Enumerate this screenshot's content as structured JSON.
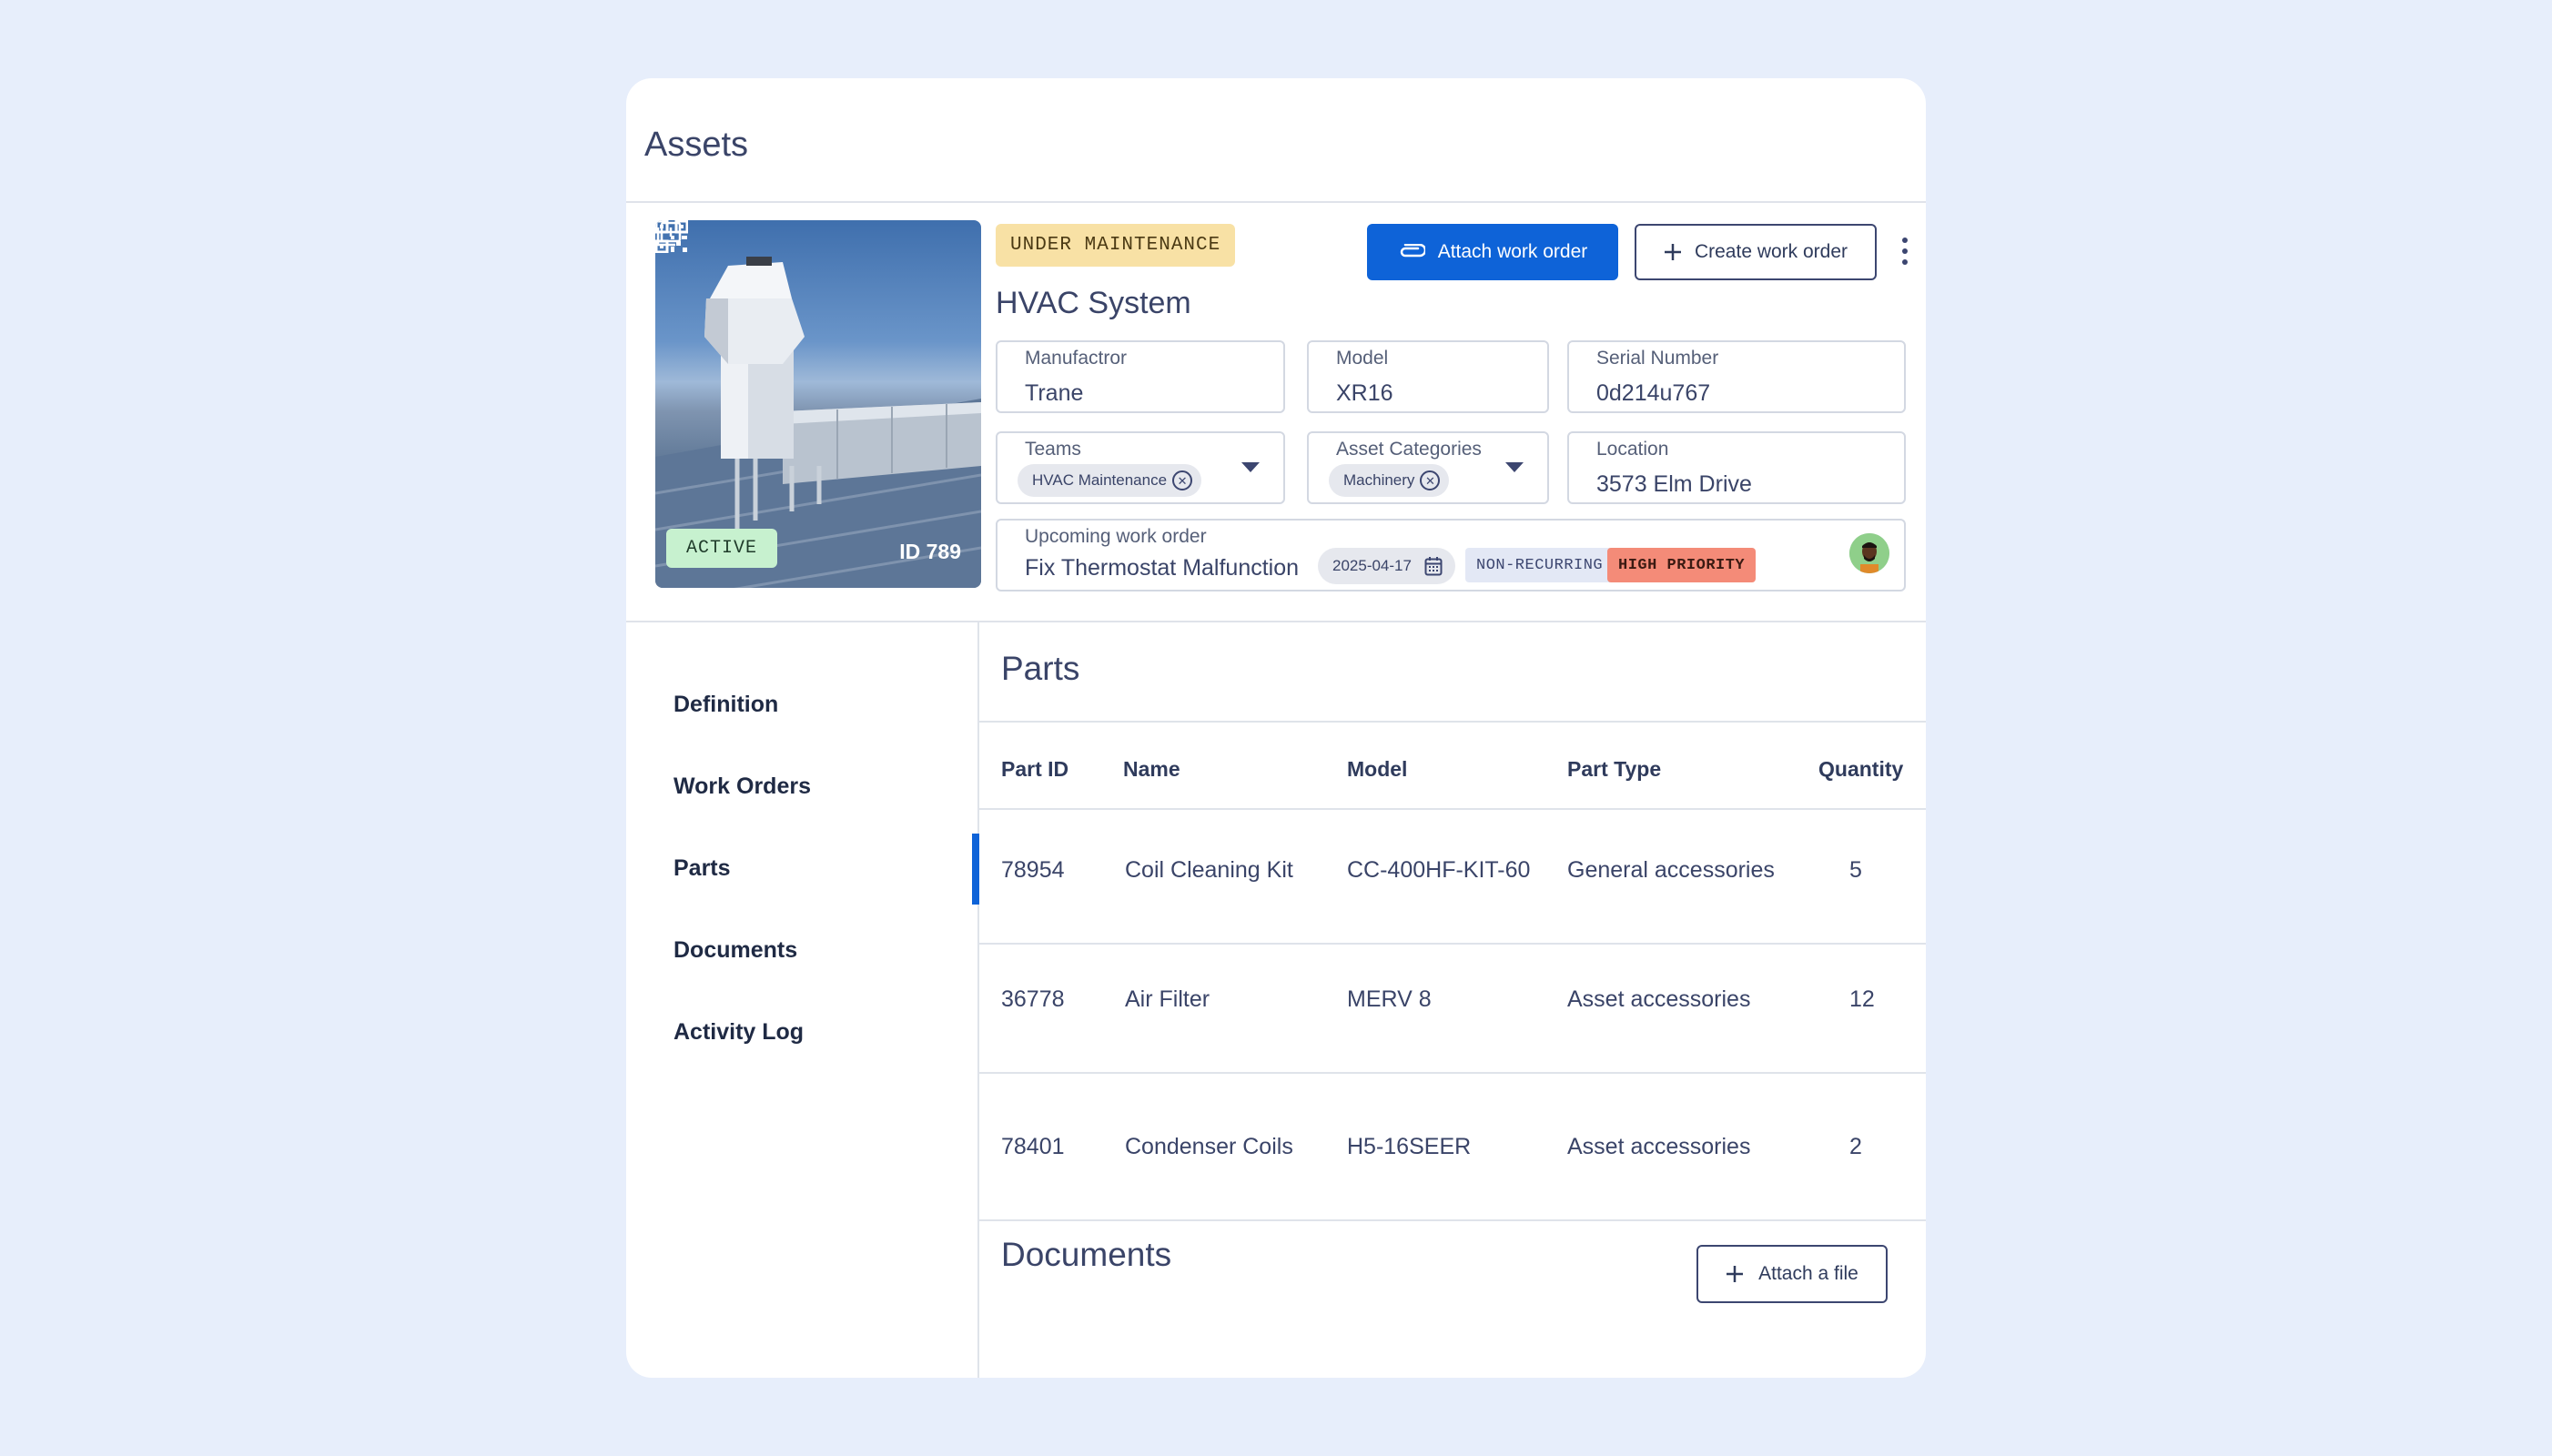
{
  "page": {
    "title": "Assets"
  },
  "asset": {
    "status": "UNDER MAINTENANCE",
    "name": "HVAC System",
    "state_badge": "ACTIVE",
    "id_label": "ID 789",
    "image_icons": {
      "qr": "qr-code-icon",
      "add_image": "add-image-icon"
    }
  },
  "actions": {
    "attach_work_order": "Attach work order",
    "create_work_order": "Create work order",
    "more_icon": "kebab-menu-icon"
  },
  "fields": {
    "manufacturer": {
      "label": "Manufactror",
      "value": "Trane"
    },
    "model": {
      "label": "Model",
      "value": "XR16"
    },
    "serial": {
      "label": "Serial Number",
      "value": "0d214u767"
    },
    "teams": {
      "label": "Teams",
      "chip": "HVAC Maintenance"
    },
    "categories": {
      "label": "Asset Categories",
      "chip": "Machinery"
    },
    "location": {
      "label": "Location",
      "value": "3573 Elm Drive"
    }
  },
  "upcoming": {
    "label": "Upcoming work order",
    "title": "Fix Thermostat Malfunction",
    "date": "2025-04-17",
    "recurrence": "NON-RECURRING",
    "priority": "HIGH PRIORITY"
  },
  "nav": {
    "items": [
      "Definition",
      "Work Orders",
      "Parts",
      "Documents",
      "Activity Log"
    ],
    "selected": "Parts"
  },
  "parts": {
    "title": "Parts",
    "columns": [
      "Part ID",
      "Name",
      "Model",
      "Part Type",
      "Quantity"
    ],
    "rows": [
      [
        "78954",
        "Coil Cleaning Kit",
        "CC-400HF-KIT-60",
        "General accessories",
        "5"
      ],
      [
        "36778",
        "Air Filter",
        "MERV 8",
        "Asset accessories",
        "12"
      ],
      [
        "78401",
        "Condenser Coils",
        "H5-16SEER",
        "Asset accessories",
        "2"
      ]
    ]
  },
  "documents": {
    "title": "Documents",
    "attach_label": "Attach a file"
  },
  "colors": {
    "background": "#e7eefb",
    "primary": "#0e63d8",
    "maintenance_badge": "#f8e1a5",
    "active_badge": "#c7f1cf",
    "high_priority": "#f48b78"
  }
}
